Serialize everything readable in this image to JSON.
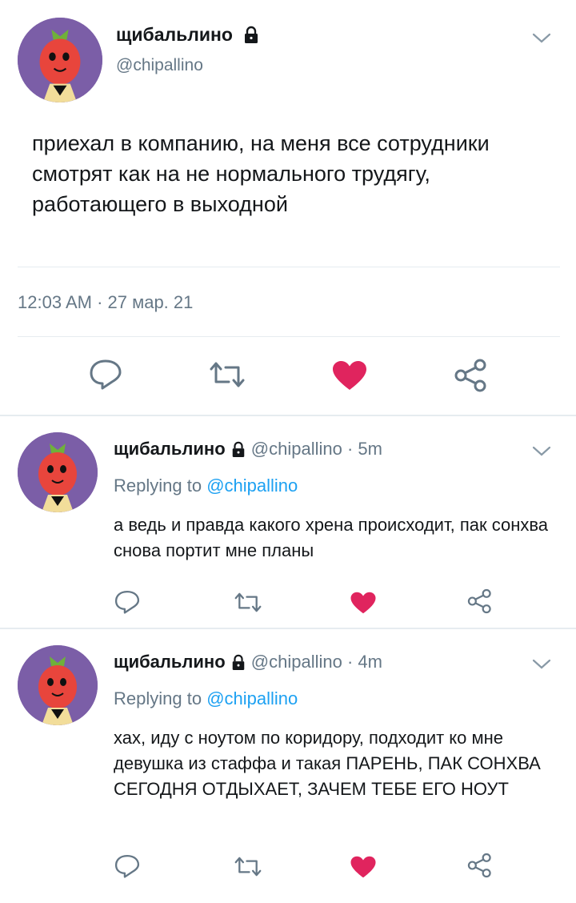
{
  "main_tweet": {
    "display_name": "щибальлино",
    "handle": "@chipallino",
    "text": "приехал в компанию, на меня все сотрудники смотрят как на не нормального трудягу, работающего в выходной",
    "timestamp": "12:03 AM · 27 мар. 21",
    "avatar_icon": "cipollino-avatar",
    "lock_icon": "lock-icon",
    "menu_icon": "chevron-down-icon"
  },
  "replies": [
    {
      "display_name": "щибальлино",
      "handle": "@chipallino · 5m",
      "replying_prefix": "Replying to",
      "replying_handle": "@chipallino",
      "text": "а ведь и правда какого хрена происходит, пак сонхва снова портит мне планы"
    },
    {
      "display_name": "щибальлино",
      "handle": "@chipallino · 4m",
      "replying_prefix": "Replying to",
      "replying_handle": "@chipallino",
      "text": "хах, иду с ноутом по коридору, подходит ко мне девушка из стаффа и такая ПАРЕНЬ, ПАК СОНХВА СЕГОДНЯ ОТДЫХАЕТ, ЗАЧЕМ ТЕБЕ ЕГО НОУТ"
    }
  ],
  "actions": [
    "reply-icon",
    "retweet-icon",
    "like-icon",
    "share-icon"
  ],
  "colors": {
    "like": "#e0245e",
    "link": "#1da1f2",
    "muted": "#657786",
    "icon": "#657786",
    "divider": "#e6ecf0"
  }
}
